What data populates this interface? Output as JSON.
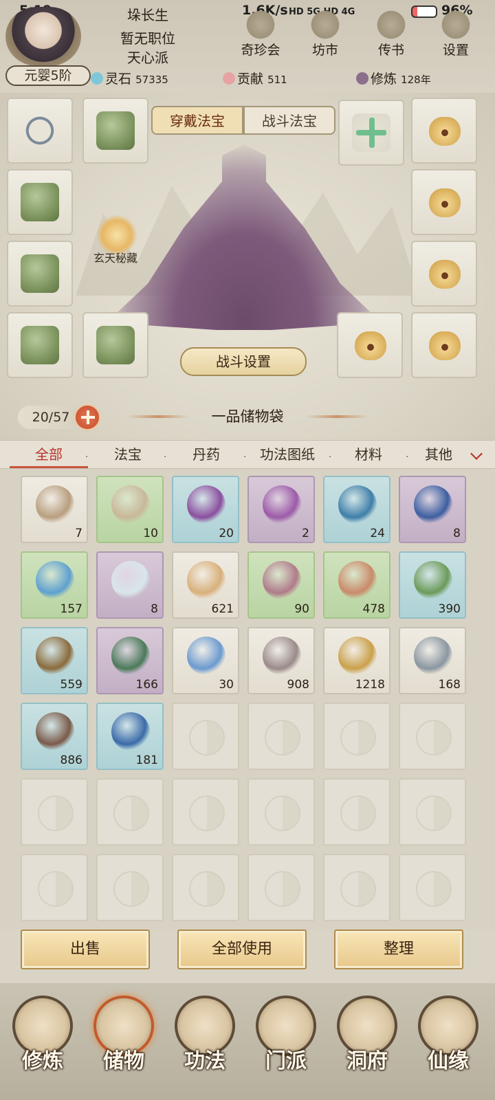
{
  "status_bar": {
    "time": "5:19",
    "speed": "1.6K/s",
    "signal": "HD 5G HD 4G",
    "battery": "96%"
  },
  "player": {
    "name": "垛长生",
    "position": "暂无职位",
    "sect": "天心派",
    "realm": "元婴5阶"
  },
  "top_menu": [
    {
      "label": "奇珍会",
      "icon": "treasure-icon"
    },
    {
      "label": "坊市",
      "icon": "market-icon"
    },
    {
      "label": "传书",
      "icon": "letter-icon"
    },
    {
      "label": "设置",
      "icon": "gear-icon"
    }
  ],
  "resources": {
    "spirit_stone": {
      "label": "灵石",
      "value": "57335"
    },
    "contribution": {
      "label": "贡献",
      "value": "511"
    },
    "cultivation": {
      "label": "修炼",
      "value": "128年"
    }
  },
  "equip_tabs": {
    "wear": "穿戴法宝",
    "battle": "战斗法宝"
  },
  "xuantian": "玄天秘藏",
  "battle_settings": "战斗设置",
  "bag": {
    "capacity": "20/57",
    "title": "一品储物袋"
  },
  "categories": [
    "全部",
    "法宝",
    "丹药",
    "功法图纸",
    "材料",
    "其他"
  ],
  "items": [
    {
      "count": "7",
      "rarity": "white",
      "color": "#b89e7e"
    },
    {
      "count": "10",
      "rarity": "green",
      "color": "#c9b79a"
    },
    {
      "count": "20",
      "rarity": "blue",
      "color": "#8a4e9e"
    },
    {
      "count": "2",
      "rarity": "purple",
      "color": "#9c5aa8"
    },
    {
      "count": "24",
      "rarity": "blue",
      "color": "#3f7ea8"
    },
    {
      "count": "8",
      "rarity": "purple",
      "color": "#3c5ea0"
    },
    {
      "count": "157",
      "rarity": "green",
      "color": "#5ea0cf"
    },
    {
      "count": "8",
      "rarity": "purple",
      "color": "#d8e6ea"
    },
    {
      "count": "621",
      "rarity": "white",
      "color": "#d8b07a"
    },
    {
      "count": "90",
      "rarity": "green",
      "color": "#b07a8a"
    },
    {
      "count": "478",
      "rarity": "green",
      "color": "#c98a6a"
    },
    {
      "count": "390",
      "rarity": "blue",
      "color": "#6c9a5a"
    },
    {
      "count": "559",
      "rarity": "blue",
      "color": "#8a6a3c"
    },
    {
      "count": "166",
      "rarity": "purple",
      "color": "#4a7a5a"
    },
    {
      "count": "30",
      "rarity": "white",
      "color": "#6a9acf"
    },
    {
      "count": "908",
      "rarity": "white",
      "color": "#9a8a8a"
    },
    {
      "count": "1218",
      "rarity": "white",
      "color": "#caa04a"
    },
    {
      "count": "168",
      "rarity": "white",
      "color": "#8a96a0"
    },
    {
      "count": "886",
      "rarity": "blue",
      "color": "#7a5a4a"
    },
    {
      "count": "181",
      "rarity": "blue",
      "color": "#3a6aa8"
    }
  ],
  "actions": {
    "sell": "出售",
    "use_all": "全部使用",
    "sort": "整理"
  },
  "bottom_nav": [
    {
      "label": "修炼",
      "icon": "meditation-icon"
    },
    {
      "label": "储物",
      "icon": "storage-bag-icon"
    },
    {
      "label": "功法",
      "icon": "scroll-icon"
    },
    {
      "label": "门派",
      "icon": "sect-gate-icon"
    },
    {
      "label": "洞府",
      "icon": "cave-icon"
    },
    {
      "label": "仙缘",
      "icon": "fate-icon"
    }
  ],
  "colors": {
    "accent": "#b8332a",
    "gold": "#e8c88a"
  }
}
